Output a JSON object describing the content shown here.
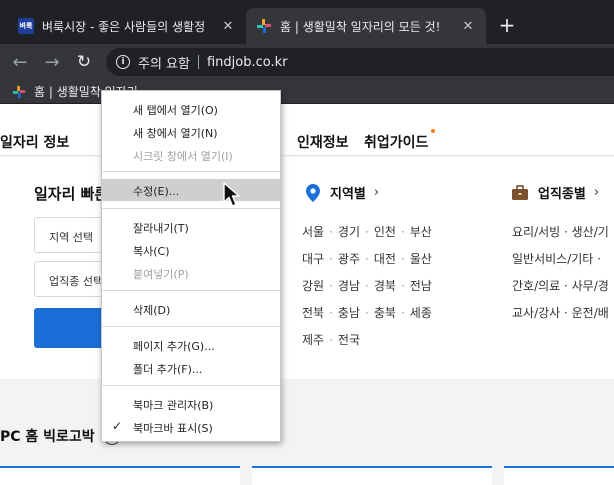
{
  "browser": {
    "tabs": [
      {
        "title": "벼룩시장 - 좋은 사람들의 생활정",
        "active": false
      },
      {
        "title": "홈 | 생활밀착 일자리의 모든 것!",
        "active": true
      }
    ],
    "new_tab": "+",
    "address": {
      "security": "주의 요함",
      "url": "findjob.co.kr"
    },
    "bookmark_item": "홈 | 생활밀착 일자리"
  },
  "page": {
    "nav": [
      {
        "label": "일자리 정보"
      },
      {
        "label": "인재정보"
      },
      {
        "label": "취업가이드",
        "has_dot": true
      }
    ],
    "quick_search": {
      "title": "일자리 빠른",
      "region_select": "지역 선택",
      "job_select": "업직종 선택"
    },
    "region": {
      "title": "지역별",
      "rows": [
        [
          "서울",
          "경기",
          "인천",
          "부산"
        ],
        [
          "대구",
          "광주",
          "대전",
          "울산"
        ],
        [
          "강원",
          "경남",
          "경북",
          "전남"
        ],
        [
          "전북",
          "충남",
          "충북",
          "세종"
        ],
        [
          "제주",
          "전국"
        ]
      ]
    },
    "job_category": {
      "title": "업직종별",
      "rows": [
        "요리/서빙 · 생산/기",
        "일반서비스/기타 · ",
        "간호/의료 · 사무/경",
        "교사/강사 · 운전/배"
      ]
    },
    "pc_section_title": "PC 홈 빅로고박"
  },
  "context_menu": {
    "items": [
      {
        "label": "새 탭에서 열기(O)",
        "disabled": false
      },
      {
        "label": "새 창에서 열기(N)",
        "disabled": false
      },
      {
        "label": "시크릿 창에서 열기(I)",
        "disabled": true
      },
      {
        "label": "수정(E)...",
        "disabled": false,
        "hover": true
      },
      {
        "label": "잘라내기(T)",
        "disabled": false
      },
      {
        "label": "복사(C)",
        "disabled": false
      },
      {
        "label": "붙여넣기(P)",
        "disabled": true
      },
      {
        "label": "삭제(D)",
        "disabled": false
      },
      {
        "label": "페이지 추가(G)...",
        "disabled": false
      },
      {
        "label": "폴더 추가(F)...",
        "disabled": false
      },
      {
        "label": "북마크 관리자(B)",
        "disabled": false
      },
      {
        "label": "북마크바 표시(S)",
        "disabled": false,
        "checked": true
      }
    ]
  },
  "colors": {
    "accent": "#1b6fd8",
    "chrome_dark": "#202124",
    "chrome_mid": "#35363a",
    "dot": "#ff7a1a"
  }
}
